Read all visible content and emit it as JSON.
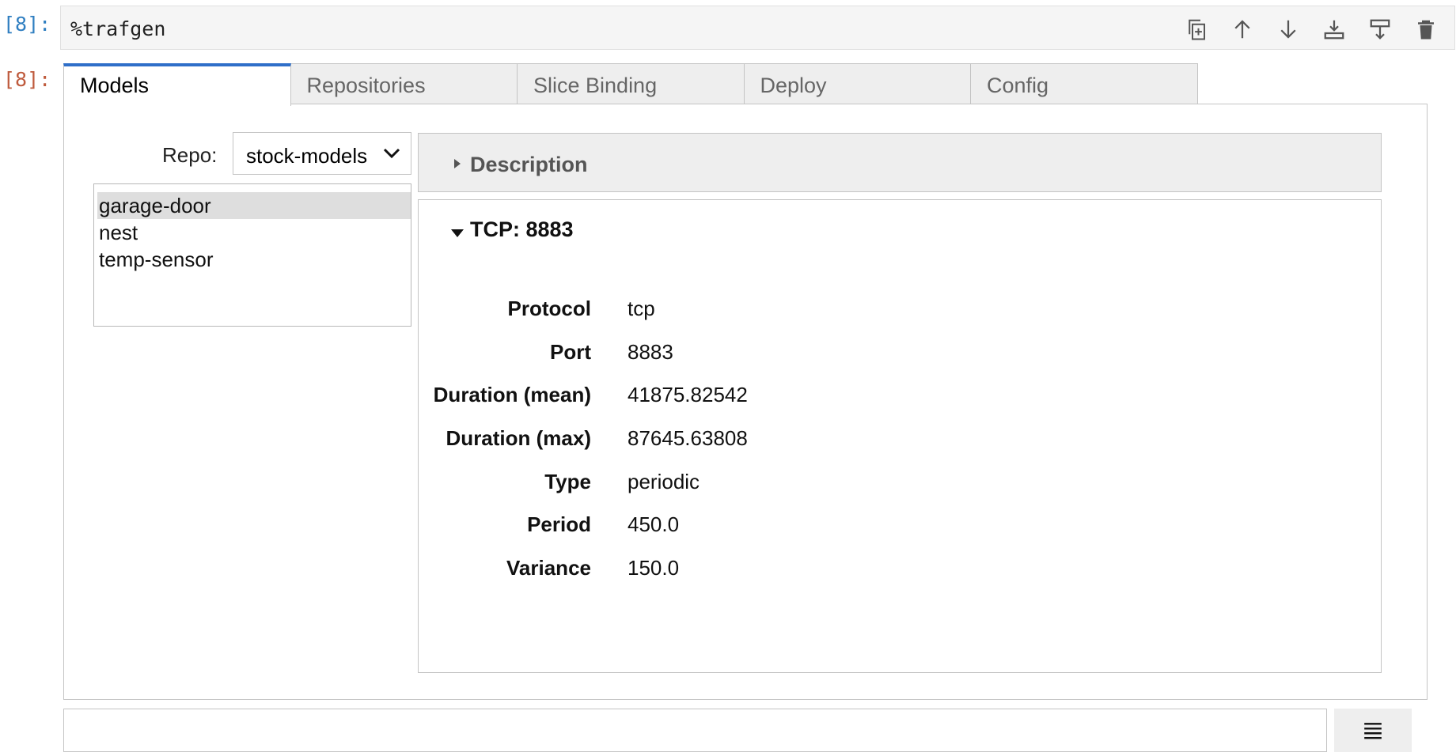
{
  "cell": {
    "input_prompt": "[8]:",
    "output_prompt": "[8]:",
    "code": "%trafgen",
    "toolbar": [
      "duplicate-icon",
      "move-up-icon",
      "move-down-icon",
      "insert-below-icon",
      "insert-above-icon",
      "delete-icon"
    ]
  },
  "tabs": [
    {
      "label": "Models",
      "active": true
    },
    {
      "label": "Repositories"
    },
    {
      "label": "Slice Binding"
    },
    {
      "label": "Deploy"
    },
    {
      "label": "Config"
    }
  ],
  "repo": {
    "label": "Repo:",
    "selected": "stock-models"
  },
  "models": [
    "garage-door",
    "nest",
    "temp-sensor"
  ],
  "selected_model": "garage-door",
  "description": {
    "title": "Description",
    "expanded": false
  },
  "tcp": {
    "title": "TCP: 8883",
    "expanded": true,
    "properties": [
      {
        "key": "Protocol",
        "value": "tcp"
      },
      {
        "key": "Port",
        "value": "8883"
      },
      {
        "key": "Duration (mean)",
        "value": "41875.82542"
      },
      {
        "key": "Duration (max)",
        "value": "87645.63808"
      },
      {
        "key": "Type",
        "value": "periodic"
      },
      {
        "key": "Period",
        "value": "450.0"
      },
      {
        "key": "Variance",
        "value": "150.0"
      }
    ]
  },
  "colors": {
    "accent": "#2f6fc9",
    "input_prompt": "#307fc1",
    "output_prompt": "#bf5b3d"
  }
}
